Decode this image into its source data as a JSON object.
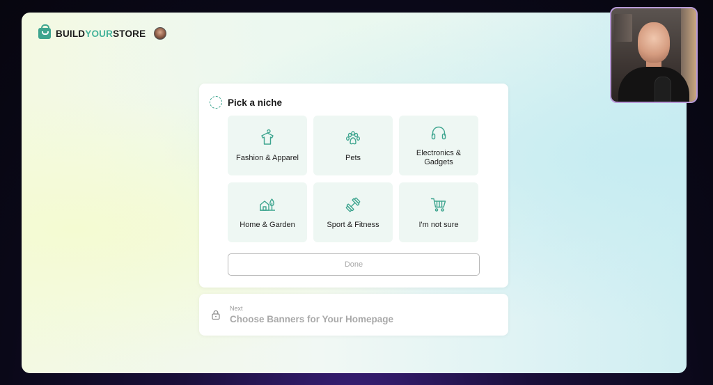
{
  "brand": {
    "name_part1": "BUILD",
    "name_part2": "YOUR",
    "name_part3": "STORE",
    "accent_color": "#45b39a"
  },
  "step": {
    "title": "Pick a niche",
    "done_label": "Done",
    "niches": [
      {
        "label": "Fashion & Apparel",
        "icon": "shirt-icon"
      },
      {
        "label": "Pets",
        "icon": "paw-icon"
      },
      {
        "label": "Electronics & Gadgets",
        "icon": "headphones-icon"
      },
      {
        "label": "Home & Garden",
        "icon": "house-tree-icon"
      },
      {
        "label": "Sport & Fitness",
        "icon": "dumbbell-icon"
      },
      {
        "label": "I'm not sure",
        "icon": "cart-icon"
      }
    ]
  },
  "next_step": {
    "small_label": "Next",
    "title": "Choose Banners for Your Homepage",
    "icon": "lock-icon"
  },
  "colors": {
    "tile_bg": "#eef7f3",
    "icon_stroke": "#3ea58f"
  }
}
